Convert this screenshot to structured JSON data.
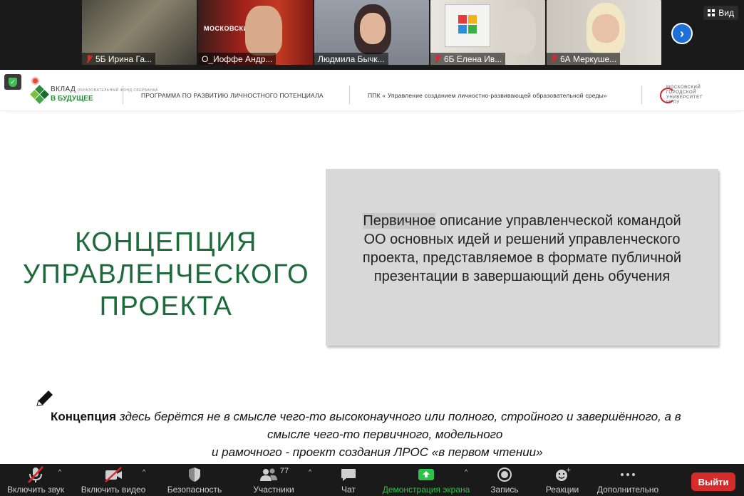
{
  "window": {
    "view_label": "Вид"
  },
  "participants_strip": [
    {
      "name": "5Б  Ирина Га...",
      "muted": true,
      "bg": "#6b6a5e",
      "active": false
    },
    {
      "name": "О_Иоффе Андр...",
      "muted": false,
      "bg": "#b8261f",
      "active": true
    },
    {
      "name": "Людмила Бычк...",
      "muted": false,
      "bg": "#8a8f9a",
      "active": false
    },
    {
      "name": "6Б  Елена Ив...",
      "muted": true,
      "bg": "#d9d6cf",
      "active": false
    },
    {
      "name": "6А  Меркуше...",
      "muted": true,
      "bg": "#c9c7bf",
      "active": false
    }
  ],
  "tile_overlay": {
    "label": "МОСКОВСКИЙ"
  },
  "slide": {
    "logo_left": {
      "line1": "ВКЛАД",
      "line1_small": "ОБРАЗОВАТЕЛЬНЫЙ ФОНД СБЕРБАНКА",
      "line2": "В БУДУЩЕЕ"
    },
    "program_text": "ПРОГРАММА ПО РАЗВИТИЮ ЛИЧНОСТНОГО ПОТЕНЦИАЛА",
    "ppk_text": "ППК « Управление созданием личностно-развивающей образовательной среды»",
    "logo_right": {
      "l1": "МОСКОВСКИЙ",
      "l2": "ГОРОДСКОЙ",
      "l3": "УНИВЕРСИТЕТ",
      "l4": "МГПУ"
    },
    "title_lines": [
      "КОНЦЕПЦИЯ",
      "УПРАВЛЕНЧЕСКОГО",
      "ПРОЕКТА"
    ],
    "definition": {
      "highlight": "Первичное",
      "line1_rest": " описание управленческой командой",
      "line2": "ОО основных идей и решений управленческого",
      "line3": "проекта, представляемое в формате публичной",
      "line4": "презентации в завершающий день обучения"
    },
    "note": {
      "bold": "Концепция",
      "line1_rest": " здесь берётся не в смысле чего-то высоконаучного или полного, стройного и завершённого, а в",
      "line2": "смысле чего-то первичного, модельного",
      "line3": "и рамочного - проект создания ЛРОС «в первом чтении»"
    }
  },
  "toolbar": {
    "audio": "Включить звук",
    "video": "Включить видео",
    "security": "Безопасность",
    "participants": "Участники",
    "participants_count": "77",
    "chat": "Чат",
    "share": "Демонстрация экрана",
    "record": "Запись",
    "reactions": "Реакции",
    "more": "Дополнительно",
    "leave": "Выйти"
  },
  "colors": {
    "share_green": "#2ec24a",
    "leave_red": "#d72b2b",
    "title_green": "#1d6b3a"
  }
}
